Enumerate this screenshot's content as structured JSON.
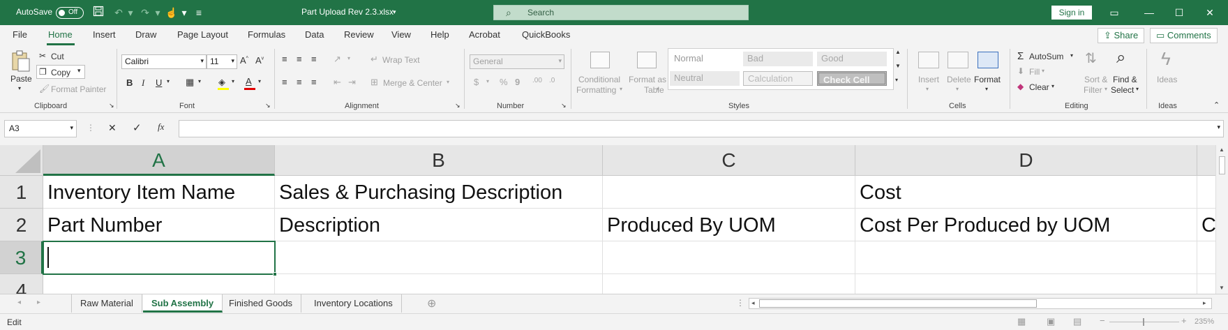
{
  "titlebar": {
    "autosave_label": "AutoSave",
    "autosave_state": "Off",
    "filename": "Part Upload Rev 2.3.xlsx",
    "search_placeholder": "Search",
    "signin_label": "Sign in"
  },
  "menu": {
    "items": [
      "File",
      "Home",
      "Insert",
      "Draw",
      "Page Layout",
      "Formulas",
      "Data",
      "Review",
      "View",
      "Help",
      "Acrobat",
      "QuickBooks"
    ],
    "active": "Home",
    "share_label": "Share",
    "comments_label": "Comments"
  },
  "ribbon": {
    "clipboard": {
      "paste": "Paste",
      "cut": "Cut",
      "copy": "Copy",
      "format_painter": "Format Painter",
      "label": "Clipboard"
    },
    "font": {
      "family": "Calibri",
      "size": "11",
      "label": "Font"
    },
    "alignment": {
      "wrap_text": "Wrap Text",
      "merge_center": "Merge & Center",
      "label": "Alignment"
    },
    "number": {
      "format": "General",
      "label": "Number"
    },
    "styles": {
      "conditional_formatting": [
        "Conditional",
        "Formatting"
      ],
      "format_as_table": [
        "Format as",
        "Table"
      ],
      "cells": [
        "Normal",
        "Bad",
        "Good",
        "Neutral",
        "Calculation",
        "Check Cell"
      ],
      "label": "Styles"
    },
    "cells": {
      "insert": "Insert",
      "delete": "Delete",
      "format": "Format",
      "label": "Cells"
    },
    "editing": {
      "autosum": "AutoSum",
      "fill": "Fill",
      "clear": "Clear",
      "sort_filter": [
        "Sort &",
        "Filter"
      ],
      "find_select": [
        "Find &",
        "Select"
      ],
      "label": "Editing"
    },
    "ideas": {
      "ideas": "Ideas",
      "label": "Ideas"
    }
  },
  "formula_bar": {
    "name_box": "A3",
    "formula": ""
  },
  "grid": {
    "columns": [
      "A",
      "B",
      "C",
      "D"
    ],
    "selected_column": "A",
    "rows": [
      "1",
      "2",
      "3",
      "4"
    ],
    "selected_row": "3",
    "cells": {
      "A1": "Inventory Item Name",
      "B1": "Sales & Purchasing Description",
      "C1": "",
      "D1": "Cost",
      "A2": "Part Number",
      "B2": "Description",
      "C2": "Produced By UOM",
      "D2": "Cost Per Produced by UOM",
      "E2": "C"
    },
    "active_cell": "A3"
  },
  "sheets": {
    "tabs": [
      "Raw Material",
      "Sub Assembly",
      "Finished Goods",
      "Inventory Locations"
    ],
    "active": "Sub Assembly"
  },
  "status": {
    "mode": "Edit",
    "zoom": "235%"
  }
}
